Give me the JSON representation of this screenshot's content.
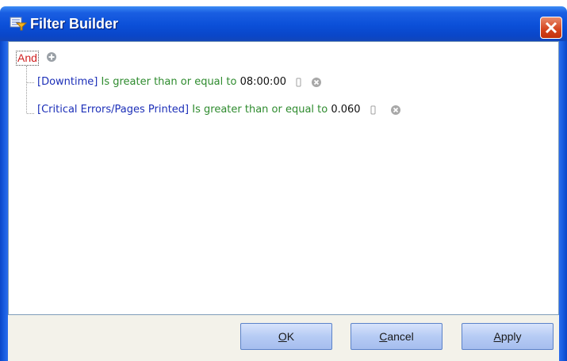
{
  "window": {
    "title": "Filter Builder"
  },
  "tree": {
    "root_group": "And",
    "conditions": [
      {
        "field": "[Downtime]",
        "operator": "Is greater than or equal to",
        "value": "08:00:00"
      },
      {
        "field": "[Critical Errors/Pages Printed]",
        "operator": "Is greater than or equal to",
        "value": "0.060"
      }
    ]
  },
  "buttons": {
    "ok": {
      "mnemonic": "O",
      "rest": "K"
    },
    "cancel": {
      "mnemonic": "C",
      "rest": "ancel"
    },
    "apply": {
      "mnemonic": "A",
      "rest": "pply"
    }
  },
  "icons": {
    "title": "filter-builder-icon",
    "close": "close-icon",
    "add": "add-condition-icon",
    "value_placeholder": "value-edit-icon",
    "remove": "remove-condition-icon"
  },
  "colors": {
    "titlebar": "#0a46c8",
    "group_operator": "#d01e1e",
    "field": "#1c2fb8",
    "operator": "#2e8b2e",
    "button": "#b6cbf4"
  }
}
